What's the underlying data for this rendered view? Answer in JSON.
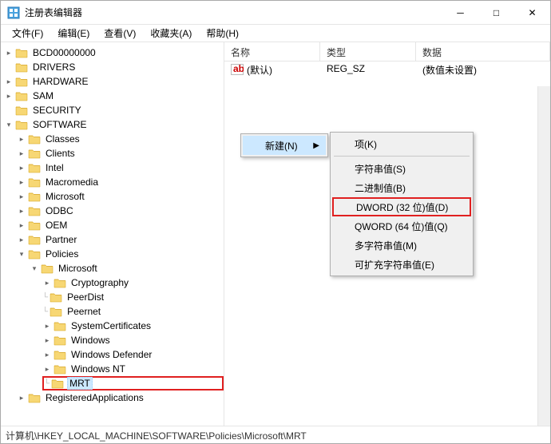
{
  "window": {
    "title": "注册表编辑器",
    "min": "─",
    "max": "□",
    "close": "✕"
  },
  "menu": {
    "file": "文件(F)",
    "edit": "编辑(E)",
    "view": "查看(V)",
    "favorites": "收藏夹(A)",
    "help": "帮助(H)"
  },
  "tree": {
    "bcd": "BCD00000000",
    "drivers": "DRIVERS",
    "hardware": "HARDWARE",
    "sam": "SAM",
    "security": "SECURITY",
    "software": "SOFTWARE",
    "classes": "Classes",
    "clients": "Clients",
    "intel": "Intel",
    "macromedia": "Macromedia",
    "microsoft": "Microsoft",
    "odbc": "ODBC",
    "oem": "OEM",
    "partner": "Partner",
    "policies": "Policies",
    "pol_microsoft": "Microsoft",
    "cryptography": "Cryptography",
    "peerdist": "PeerDist",
    "peernet": "Peernet",
    "systemcertificates": "SystemCertificates",
    "windows": "Windows",
    "windows_defender": "Windows Defender",
    "windows_nt": "Windows NT",
    "mrt": "MRT",
    "registeredapps": "RegisteredApplications"
  },
  "list": {
    "col_name": "名称",
    "col_type": "类型",
    "col_data": "数据",
    "default_name": "(默认)",
    "default_type": "REG_SZ",
    "default_data": "(数值未设置)"
  },
  "ctx": {
    "new": "新建(N)",
    "key": "项(K)",
    "string": "字符串值(S)",
    "binary": "二进制值(B)",
    "dword": "DWORD (32 位)值(D)",
    "qword": "QWORD (64 位)值(Q)",
    "multistring": "多字符串值(M)",
    "expandstring": "可扩充字符串值(E)"
  },
  "status": {
    "path": "计算机\\HKEY_LOCAL_MACHINE\\SOFTWARE\\Policies\\Microsoft\\MRT"
  }
}
